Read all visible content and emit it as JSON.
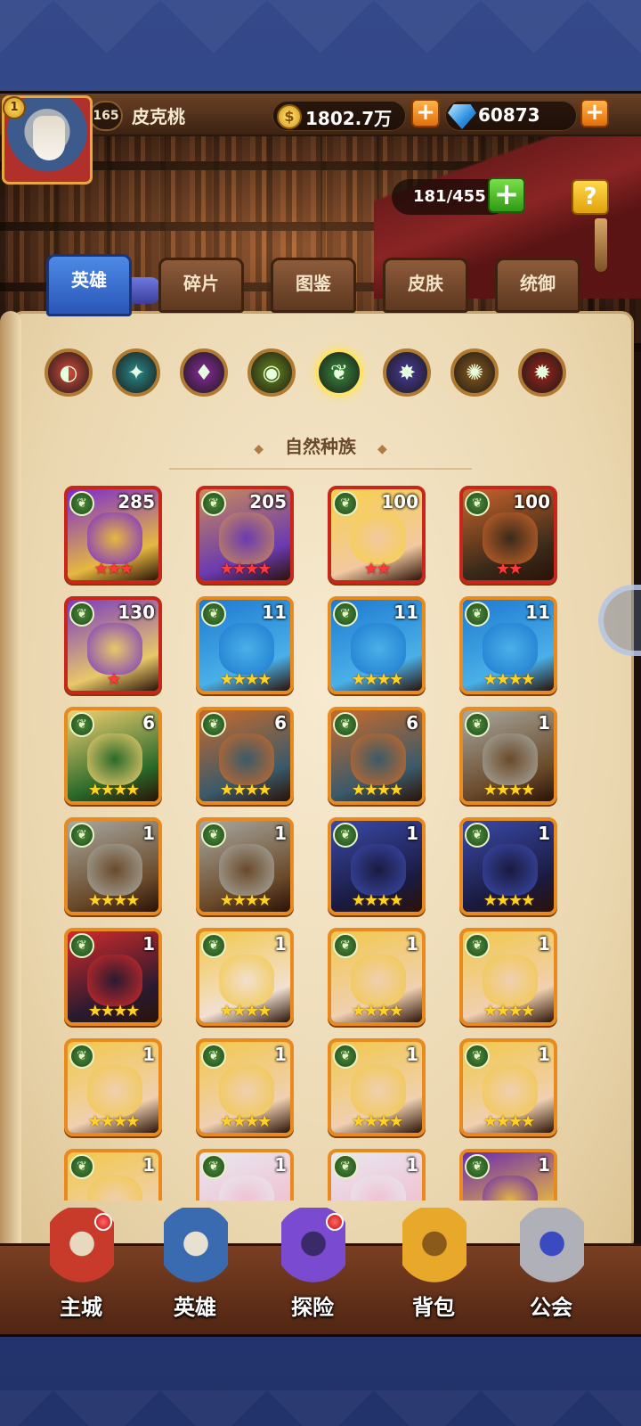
{
  "player": {
    "name": "皮克桃",
    "level": "165",
    "vip": "1"
  },
  "resources": {
    "gold": "1802.7万",
    "gems": "60873",
    "gold_icon": "coin-icon",
    "gem_icon": "gem-icon",
    "plus": "+"
  },
  "hero_capacity": "181/455",
  "help": "?",
  "tabs": [
    {
      "label": "英雄",
      "active": true
    },
    {
      "label": "碎片"
    },
    {
      "label": "图鉴"
    },
    {
      "label": "皮肤"
    },
    {
      "label": "统御"
    }
  ],
  "race_filters": [
    {
      "name": "all-races",
      "glyph": "◐",
      "color": "#d94a3a"
    },
    {
      "name": "forest",
      "glyph": "✦",
      "color": "#2a8a8a"
    },
    {
      "name": "shadow",
      "glyph": "♦",
      "color": "#8a2a9a"
    },
    {
      "name": "fortress",
      "glyph": "◉",
      "color": "#6a8a1a"
    },
    {
      "name": "nature",
      "glyph": "❦",
      "color": "#3a8a3a",
      "selected": true
    },
    {
      "name": "abyss",
      "glyph": "✸",
      "color": "#4a3a9a"
    },
    {
      "name": "light",
      "glyph": "✺",
      "color": "#8a5a1a"
    },
    {
      "name": "dark",
      "glyph": "✹",
      "color": "#a0231a"
    }
  ],
  "section_title": "自然种族",
  "heroes": [
    {
      "level": "285",
      "stars": "★★★",
      "frame": "red",
      "palette": [
        "#7a2ad0",
        "#e6b840"
      ]
    },
    {
      "level": "205",
      "stars": "★★★★",
      "frame": "red",
      "palette": [
        "#c98a5a",
        "#6a3ab0"
      ]
    },
    {
      "level": "100",
      "stars": "★★",
      "frame": "red",
      "palette": [
        "#f7d04a",
        "#f2c9a0"
      ]
    },
    {
      "level": "100",
      "stars": "★★",
      "frame": "red",
      "palette": [
        "#c8642a",
        "#3a2a1a"
      ]
    },
    {
      "level": "130",
      "stars": "★",
      "frame": "red",
      "palette": [
        "#7a3ac0",
        "#e8c86a"
      ]
    },
    {
      "level": "11",
      "stars": "★★★★",
      "frame": "orange",
      "palette": [
        "#1e7ad0",
        "#4ab0e8"
      ]
    },
    {
      "level": "11",
      "stars": "★★★★",
      "frame": "orange",
      "palette": [
        "#1e7ad0",
        "#4ab0e8"
      ]
    },
    {
      "level": "11",
      "stars": "★★★★",
      "frame": "orange",
      "palette": [
        "#1e7ad0",
        "#4ab0e8"
      ]
    },
    {
      "level": "6",
      "stars": "★★★★",
      "frame": "orange",
      "palette": [
        "#f2d070",
        "#2a6a2a"
      ]
    },
    {
      "level": "6",
      "stars": "★★★★",
      "frame": "orange",
      "palette": [
        "#c86a2a",
        "#3a5a6a"
      ]
    },
    {
      "level": "6",
      "stars": "★★★★",
      "frame": "orange",
      "palette": [
        "#c86a2a",
        "#3a5a6a"
      ]
    },
    {
      "level": "1",
      "stars": "★★★★",
      "frame": "orange",
      "palette": [
        "#a8a8a0",
        "#6a4a2a"
      ]
    },
    {
      "level": "1",
      "stars": "★★★★",
      "frame": "orange",
      "palette": [
        "#a8a8a0",
        "#6a4a2a"
      ]
    },
    {
      "level": "1",
      "stars": "★★★★",
      "frame": "orange",
      "palette": [
        "#a8a8a0",
        "#6a4a2a"
      ]
    },
    {
      "level": "1",
      "stars": "★★★★",
      "frame": "orange",
      "palette": [
        "#3a4aa8",
        "#1a1a40"
      ]
    },
    {
      "level": "1",
      "stars": "★★★★",
      "frame": "orange",
      "palette": [
        "#3a4aa8",
        "#1a1a40"
      ]
    },
    {
      "level": "1",
      "stars": "★★★★",
      "frame": "orange",
      "palette": [
        "#d02a2a",
        "#2a1a30"
      ]
    },
    {
      "level": "1",
      "stars": "★★★★",
      "frame": "orange",
      "palette": [
        "#f2c84a",
        "#f2e0d0"
      ]
    },
    {
      "level": "1",
      "stars": "★★★★",
      "frame": "orange",
      "palette": [
        "#f2c84a",
        "#f0d0b0"
      ]
    },
    {
      "level": "1",
      "stars": "★★★★",
      "frame": "orange",
      "palette": [
        "#f2c84a",
        "#f0d0b0"
      ]
    },
    {
      "level": "1",
      "stars": "★★★★",
      "frame": "orange",
      "palette": [
        "#f2c84a",
        "#f0d0b0"
      ]
    },
    {
      "level": "1",
      "stars": "★★★★",
      "frame": "orange",
      "palette": [
        "#f2c84a",
        "#f0d0b0"
      ]
    },
    {
      "level": "1",
      "stars": "★★★★",
      "frame": "orange",
      "palette": [
        "#f2c84a",
        "#f0d0b0"
      ]
    },
    {
      "level": "1",
      "stars": "★★★★",
      "frame": "orange",
      "palette": [
        "#f2c84a",
        "#f0d0b0"
      ]
    },
    {
      "level": "1",
      "stars": "★★★★",
      "frame": "orange",
      "palette": [
        "#f2c84a",
        "#f0d0b0"
      ]
    },
    {
      "level": "1",
      "stars": "★★★★",
      "frame": "orange",
      "palette": [
        "#e8e8f0",
        "#f0c0d0"
      ]
    },
    {
      "level": "1",
      "stars": "★★★★",
      "frame": "orange",
      "palette": [
        "#e8e8f0",
        "#f0c0d0"
      ]
    },
    {
      "level": "1",
      "stars": "★★★★",
      "frame": "orange",
      "palette": [
        "#6a2ab0",
        "#e8b840"
      ]
    }
  ],
  "nav": [
    {
      "label": "主城",
      "name": "main-city",
      "badge": true,
      "palette": [
        "#c83a2a",
        "#e8d8c0"
      ]
    },
    {
      "label": "英雄",
      "name": "heroes",
      "badge": false,
      "palette": [
        "#3a6ab0",
        "#e8e0d0"
      ]
    },
    {
      "label": "探险",
      "name": "adventure",
      "badge": true,
      "palette": [
        "#7a4ad0",
        "#3a2a6a"
      ]
    },
    {
      "label": "背包",
      "name": "backpack",
      "badge": false,
      "palette": [
        "#e8a82a",
        "#8a5a1a"
      ]
    },
    {
      "label": "公会",
      "name": "guild",
      "badge": false,
      "palette": [
        "#b0b0b8",
        "#3a4ac0"
      ]
    }
  ]
}
